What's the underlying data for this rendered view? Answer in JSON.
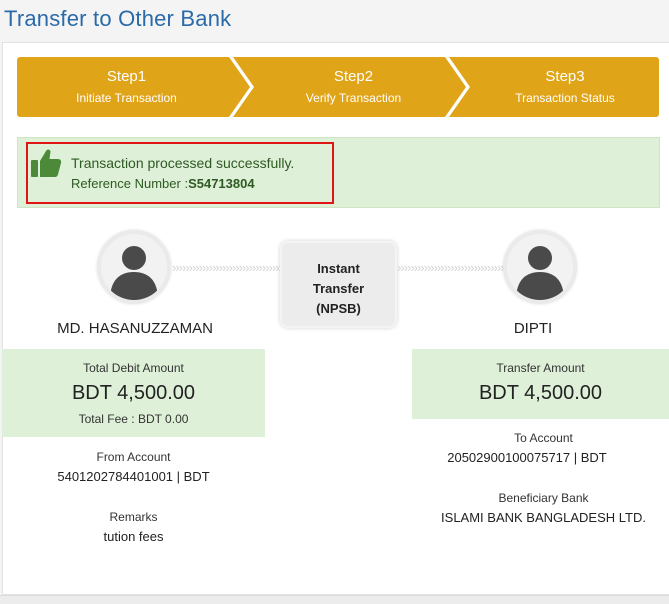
{
  "page": {
    "title": "Transfer to Other Bank"
  },
  "stepper": {
    "steps": [
      {
        "title": "Step1",
        "subtitle": "Initiate Transaction"
      },
      {
        "title": "Step2",
        "subtitle": "Verify Transaction"
      },
      {
        "title": "Step3",
        "subtitle": "Transaction Status"
      }
    ],
    "color": "#e0a419"
  },
  "status": {
    "message": "Transaction processed successfully.",
    "reference_label": "Reference Number :",
    "reference_number": "S54713804",
    "icon": "thumbs-up-icon",
    "color": "#4c8a3a"
  },
  "transfer": {
    "mode_line1": "Instant",
    "mode_line2": "Transfer",
    "mode_line3": "(NPSB)"
  },
  "sender": {
    "name": "MD. HASANUZZAMAN",
    "amount_label": "Total Debit Amount",
    "amount": "BDT  4,500.00",
    "fee_label": "Total Fee :",
    "fee_value": "BDT 0.00",
    "from_account_label": "From Account",
    "from_account": "5401202784401001 | BDT",
    "remarks_label": "Remarks",
    "remarks": "tution fees"
  },
  "receiver": {
    "name": "DIPTI",
    "amount_label": "Transfer Amount",
    "amount": "BDT  4,500.00",
    "to_account_label": "To Account",
    "to_account": "20502900100075717 | BDT",
    "bank_label": "Beneficiary Bank",
    "bank": "ISLAMI BANK BANGLADESH LTD."
  }
}
